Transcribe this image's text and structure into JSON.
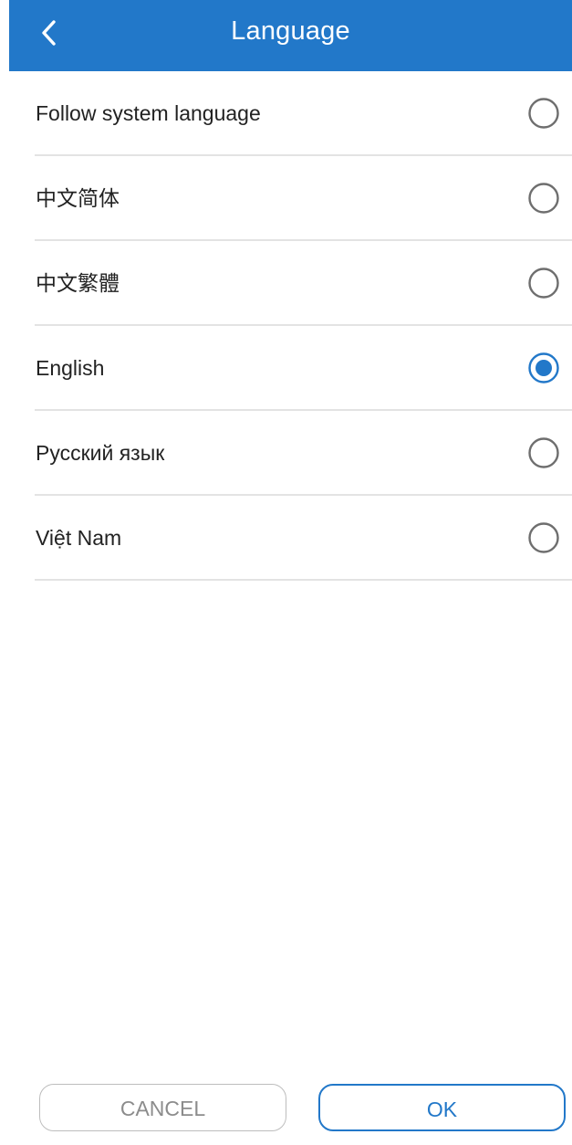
{
  "header": {
    "title": "Language",
    "back_icon": "chevron-left-icon",
    "bg_color": "#2278c9"
  },
  "languages": [
    {
      "label": "Follow system language",
      "selected": false
    },
    {
      "label": "中文简体",
      "selected": false
    },
    {
      "label": "中文繁體",
      "selected": false
    },
    {
      "label": "English",
      "selected": true
    },
    {
      "label": "Русский язык",
      "selected": false
    },
    {
      "label": "Việt Nam",
      "selected": false
    }
  ],
  "footer": {
    "cancel_label": "CANCEL",
    "ok_label": "OK"
  },
  "colors": {
    "accent": "#2278c9",
    "radio_unselected": "#6e6e6e",
    "divider": "#e3e3e3"
  }
}
